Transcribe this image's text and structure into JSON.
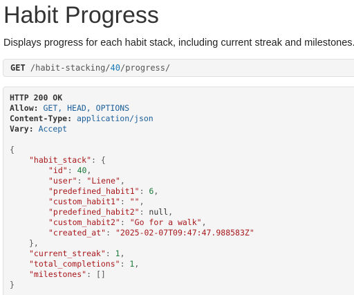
{
  "page": {
    "title": "Habit Progress",
    "description": "Displays progress for each habit stack, including current streak and milestones."
  },
  "request": {
    "method": "GET",
    "path_prefix": "/habit-stacking/",
    "path_id": "40",
    "path_suffix": "/progress/"
  },
  "response": {
    "status": "HTTP 200 OK",
    "headers": [
      {
        "name": "Allow:",
        "value": "GET, HEAD, OPTIONS"
      },
      {
        "name": "Content-Type:",
        "value": "application/json"
      },
      {
        "name": "Vary:",
        "value": "Accept"
      }
    ],
    "body": {
      "open_brace": "{",
      "close_brace": "}",
      "habit_stack_key": "\"habit_stack\"",
      "habit_stack_open": ": {",
      "habit_stack_close": "},",
      "fields": [
        {
          "key": "\"id\"",
          "value": "40",
          "type": "num",
          "comma": ","
        },
        {
          "key": "\"user\"",
          "value": "\"Liene\"",
          "type": "str",
          "comma": ","
        },
        {
          "key": "\"predefined_habit1\"",
          "value": "6",
          "type": "num",
          "comma": ","
        },
        {
          "key": "\"custom_habit1\"",
          "value": "\"\"",
          "type": "str",
          "comma": ","
        },
        {
          "key": "\"predefined_habit2\"",
          "value": "null",
          "type": "lit",
          "comma": ","
        },
        {
          "key": "\"custom_habit2\"",
          "value": "\"Go for a walk\"",
          "type": "str",
          "comma": ","
        },
        {
          "key": "\"created_at\"",
          "value": "\"2025-02-07T09:47:47.988583Z\"",
          "type": "str",
          "comma": ""
        }
      ],
      "current_streak_key": "\"current_streak\"",
      "current_streak_value": "1",
      "total_completions_key": "\"total_completions\"",
      "total_completions_value": "1",
      "milestones_key": "\"milestones\"",
      "milestones_value": "[]"
    }
  }
}
